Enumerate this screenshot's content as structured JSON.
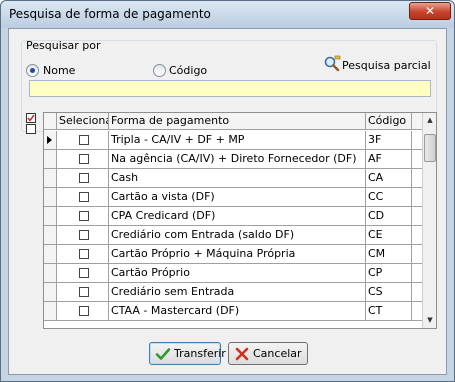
{
  "window": {
    "title": "Pesquisa de forma de pagamento",
    "close_symbol": "✕"
  },
  "search": {
    "group_label": "Pesquisar por",
    "options": [
      {
        "label": "Nome",
        "checked": true
      },
      {
        "label": "Código",
        "checked": false
      }
    ],
    "partial_label": "Pesquisa parcial",
    "value": ""
  },
  "grid": {
    "columns": [
      "Selecionar",
      "Forma de pagamento",
      "Código"
    ],
    "rows": [
      {
        "forma": "Tripla - CA/IV + DF + MP",
        "codigo": "3F"
      },
      {
        "forma": "Na agência (CA/IV) + Direto Fornecedor (DF)",
        "codigo": "AF"
      },
      {
        "forma": "Cash",
        "codigo": "CA"
      },
      {
        "forma": "Cartão a vista (DF)",
        "codigo": "CC"
      },
      {
        "forma": "CPA Credicard (DF)",
        "codigo": "CD"
      },
      {
        "forma": "Crediário com Entrada (saldo DF)",
        "codigo": "CE"
      },
      {
        "forma": "Cartão Próprio + Máquina Própria",
        "codigo": "CM"
      },
      {
        "forma": "Cartão Próprio",
        "codigo": "CP"
      },
      {
        "forma": "Crediário sem Entrada",
        "codigo": "CS"
      },
      {
        "forma": "CTAA - Mastercard (DF)",
        "codigo": "CT"
      }
    ]
  },
  "buttons": {
    "confirm_label": "Transferir",
    "cancel_label": "Cancelar"
  },
  "colors": {
    "search_bg": "#ffffc4",
    "confirm_icon": "#2e9a2e",
    "cancel_icon": "#d03020"
  }
}
